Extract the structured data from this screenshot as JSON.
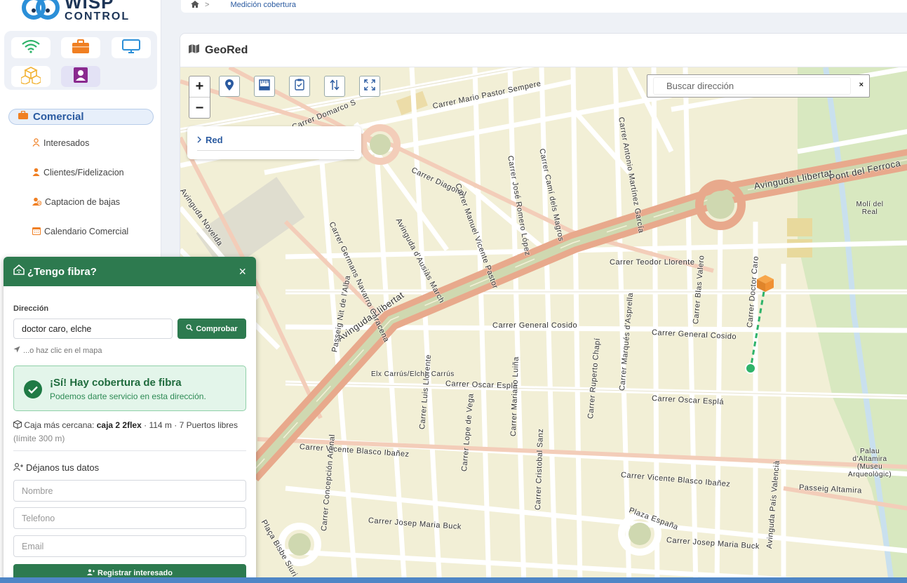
{
  "logo": {
    "line1": "WISP",
    "line2": "CONTROL"
  },
  "sidebar": {
    "section": "Comercial",
    "items": [
      {
        "label": "Interesados",
        "icon": "user-outline-icon"
      },
      {
        "label": "Clientes/Fidelizacion",
        "icon": "user-icon"
      },
      {
        "label": "Captacion de bajas",
        "icon": "user-minus-icon"
      },
      {
        "label": "Calendario Comercial",
        "icon": "calendar-icon"
      }
    ]
  },
  "breadcrumb": {
    "separator": ">",
    "current": "Medición cobertura"
  },
  "card": {
    "title": "GeoRed"
  },
  "map": {
    "zoom_in": "+",
    "zoom_out": "−",
    "layer_panel": {
      "label": "Red"
    },
    "search": {
      "placeholder": "Buscar dirección",
      "clear": "×"
    },
    "labels": {
      "mario_pastor": "Carrer Mario Pastor Sempere",
      "domarco": "Carrer Domarco S",
      "diagonal": "Carrer Diagonal",
      "germans": "Carrer Germans Navarro Caracena",
      "ausias": "Avinguda d'Ausiàs March",
      "manuel": "Carrer Manuel Vicente Pastor",
      "romero": "Carrer José Romero López",
      "cami": "Carrer Camí dels Magros",
      "antonio": "Carrer Antonio Martínez García",
      "llibertat": "Avinguda Llibertat",
      "llibertat2": "Avinguda Llibertat",
      "ferroca": "Pont del Ferroca",
      "teodor": "Carrer Teodor Llorente",
      "blas": "Carrer Blas Valero",
      "doctor_caro": "Carrer Doctor Caro",
      "general_cosido": "Carrer General Cosido",
      "general_cosido2": "Carrer General Cosido",
      "oscar": "Carrer Oscar Esplá",
      "oscar2": "Carrer Oscar Esplá",
      "vicente_blasco": "Carrer Vicente Blasco Ibañez",
      "vicente_blasco2": "Carrer Vicente Blasco Ibañez",
      "altamira": "Passeig Altamira",
      "josep_maria": "Carrer Josep Maria Buck",
      "josep_maria2": "Carrer Josep Maria Buck",
      "plaza": "Plaza España",
      "novelda": "Avinguda Novelda",
      "nit": "Passeig Nit de l'Alba",
      "elche_carrus": "Elx Carrús/Elche Carrús",
      "luis": "Carrer Luis Llorente",
      "mariano": "Carrer Mariano Luiña",
      "lope": "Carrer Lope de Vega",
      "cristobal": "Carrer Cristobal Sanz",
      "ruperto": "Carrer Ruperto Chapí",
      "marques": "Carrer Marqués d'Asprella",
      "concepcion": "Carrer Concepción Arenal",
      "pais_valencia": "Avinguda País Valencià",
      "moli": "Molí del Real",
      "palau": "Palau d'Altamira (Museu Arqueològic)",
      "placa_bisbe": "Plaça Bisbe Siuri"
    }
  },
  "fiber": {
    "title": "¿Tengo fibra?",
    "close": "×",
    "address_label": "Dirección",
    "address_value": "doctor caro, elche",
    "check_button": "Comprobar",
    "hint": "...o haz clic en el mapa",
    "result_title": "¡Sí! Hay cobertura de fibra",
    "result_sub": "Podemos darte servicio en esta dirección.",
    "box_prefix": "Caja más cercana:",
    "box_name": "caja 2 2flex",
    "box_details": "· 114 m · 7 Puertos libres",
    "box_limit": "(límite 300 m)",
    "data_title": "Déjanos tus datos",
    "name_placeholder": "Nombre",
    "phone_placeholder": "Telefono",
    "email_placeholder": "Email",
    "register_button": "Registrar interesado"
  },
  "colors": {
    "green": "#2d7a4f",
    "accent_blue": "#2a5aa0",
    "map_bg": "#f2efd6",
    "main_road": "#e8a98c"
  }
}
